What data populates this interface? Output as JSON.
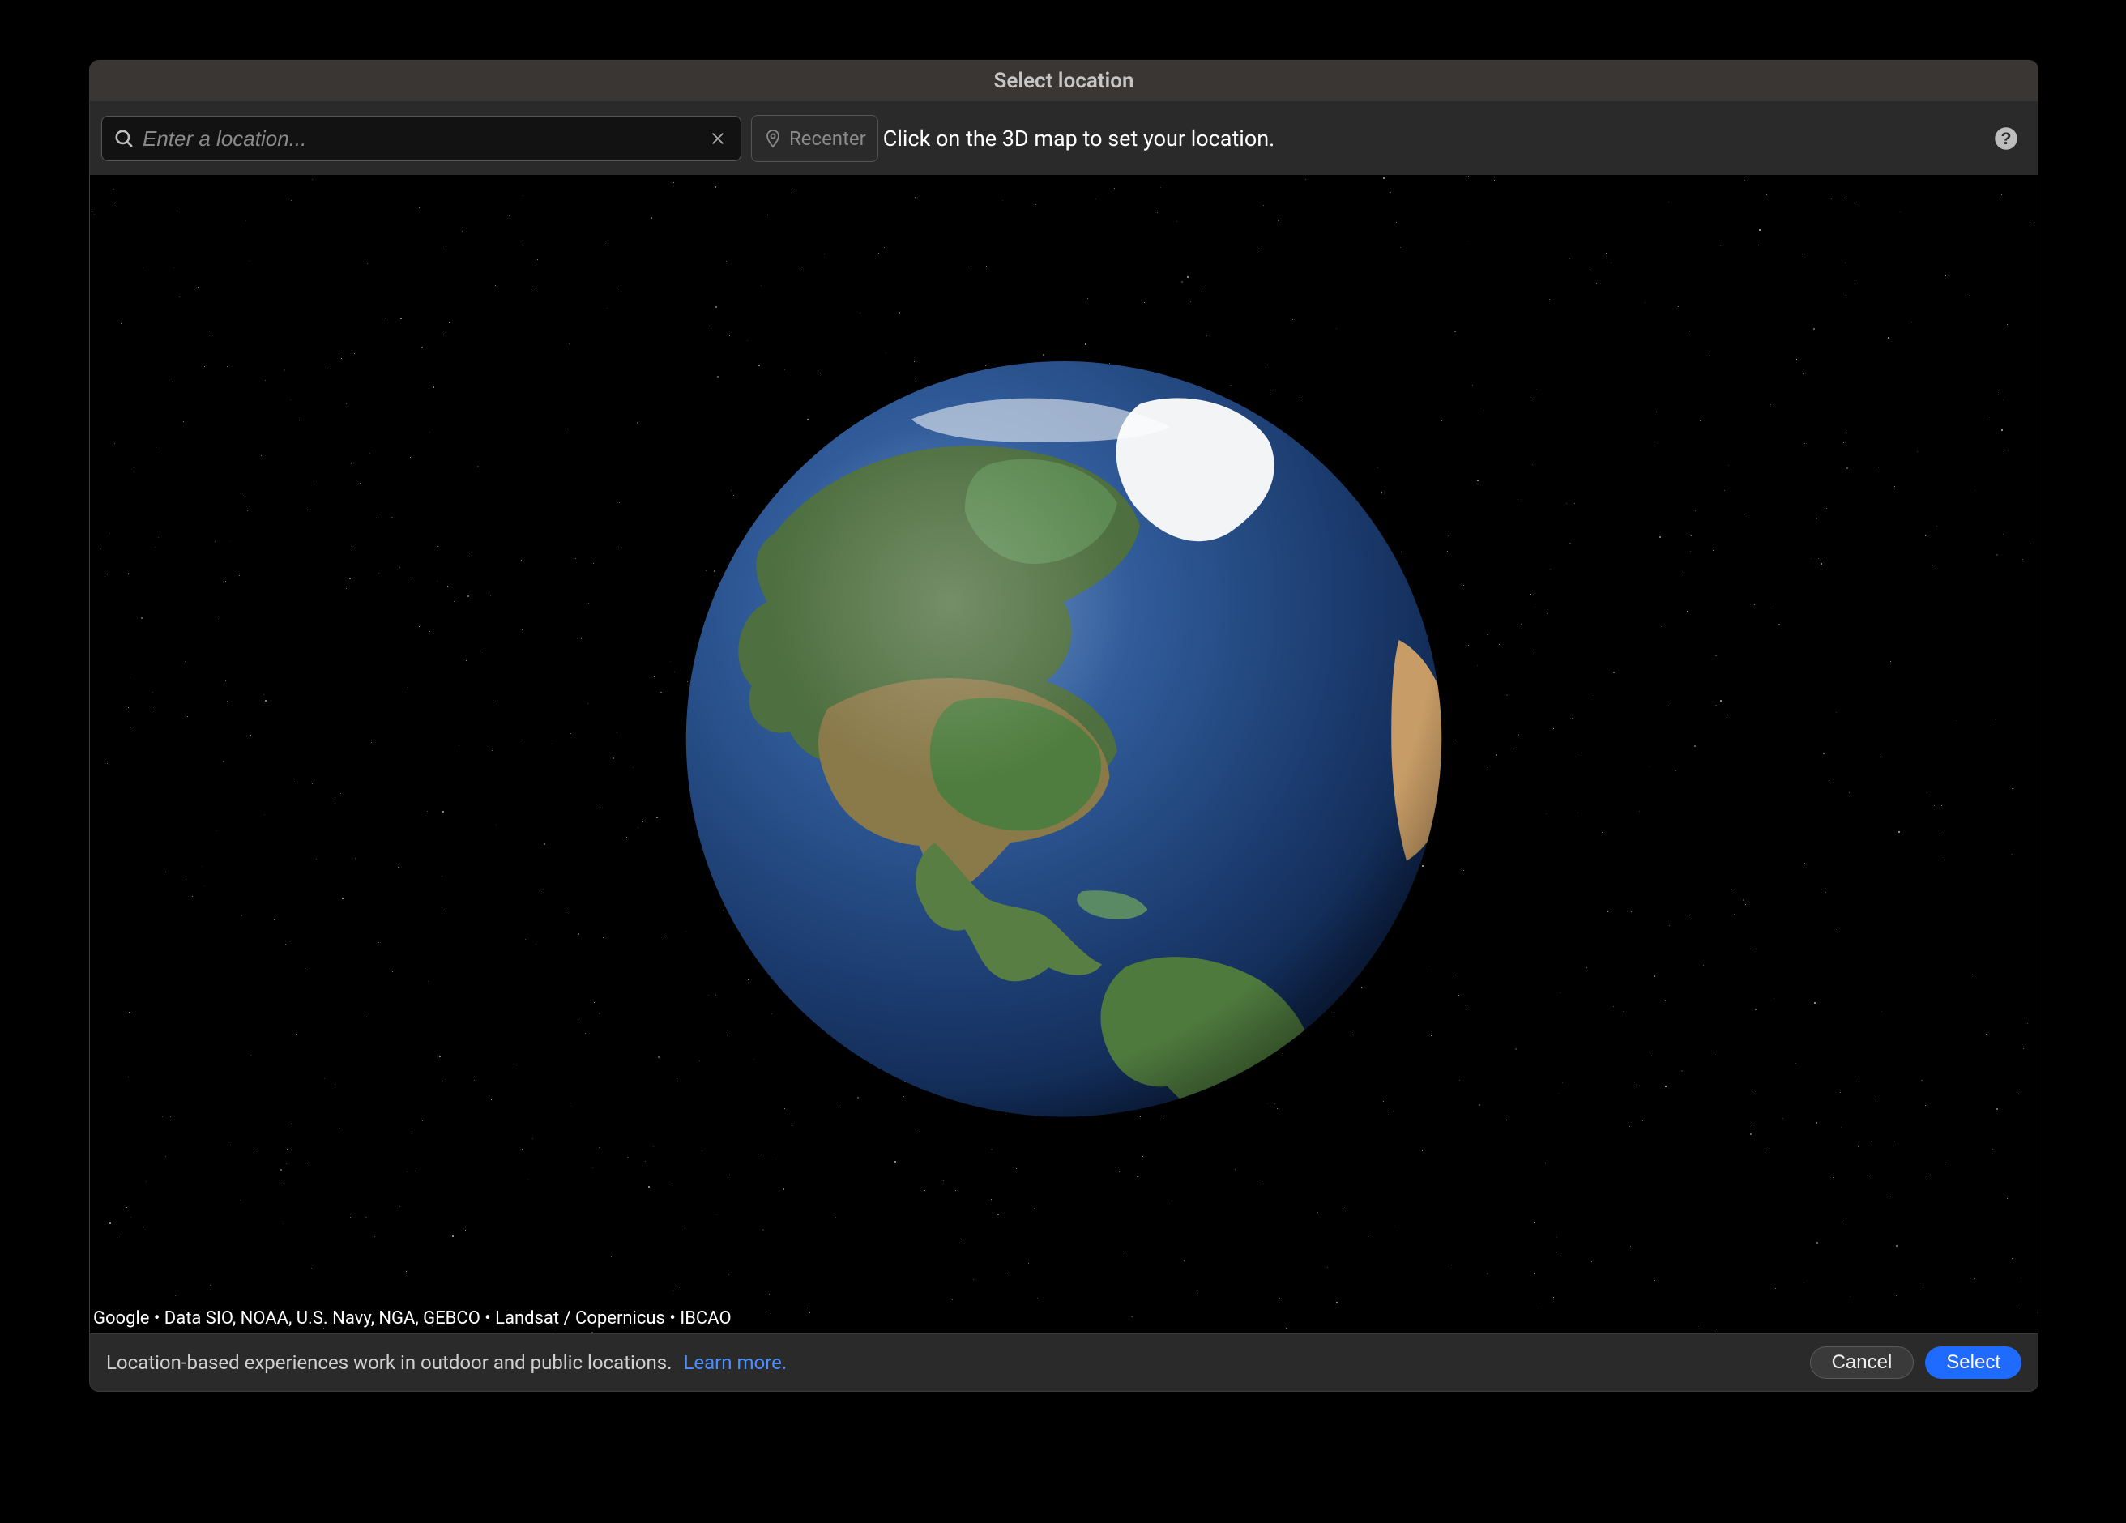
{
  "title": "Select location",
  "search": {
    "placeholder": "Enter a location...",
    "value": ""
  },
  "recenter_label": "Recenter",
  "hint": "Click on the 3D map to set your location.",
  "attribution": "Google • Data SIO, NOAA, U.S. Navy, NGA, GEBCO • Landsat / Copernicus • IBCAO",
  "footer": {
    "info": "Location-based experiences work in outdoor and public locations.",
    "learn_more": "Learn more.",
    "cancel": "Cancel",
    "select": "Select"
  }
}
